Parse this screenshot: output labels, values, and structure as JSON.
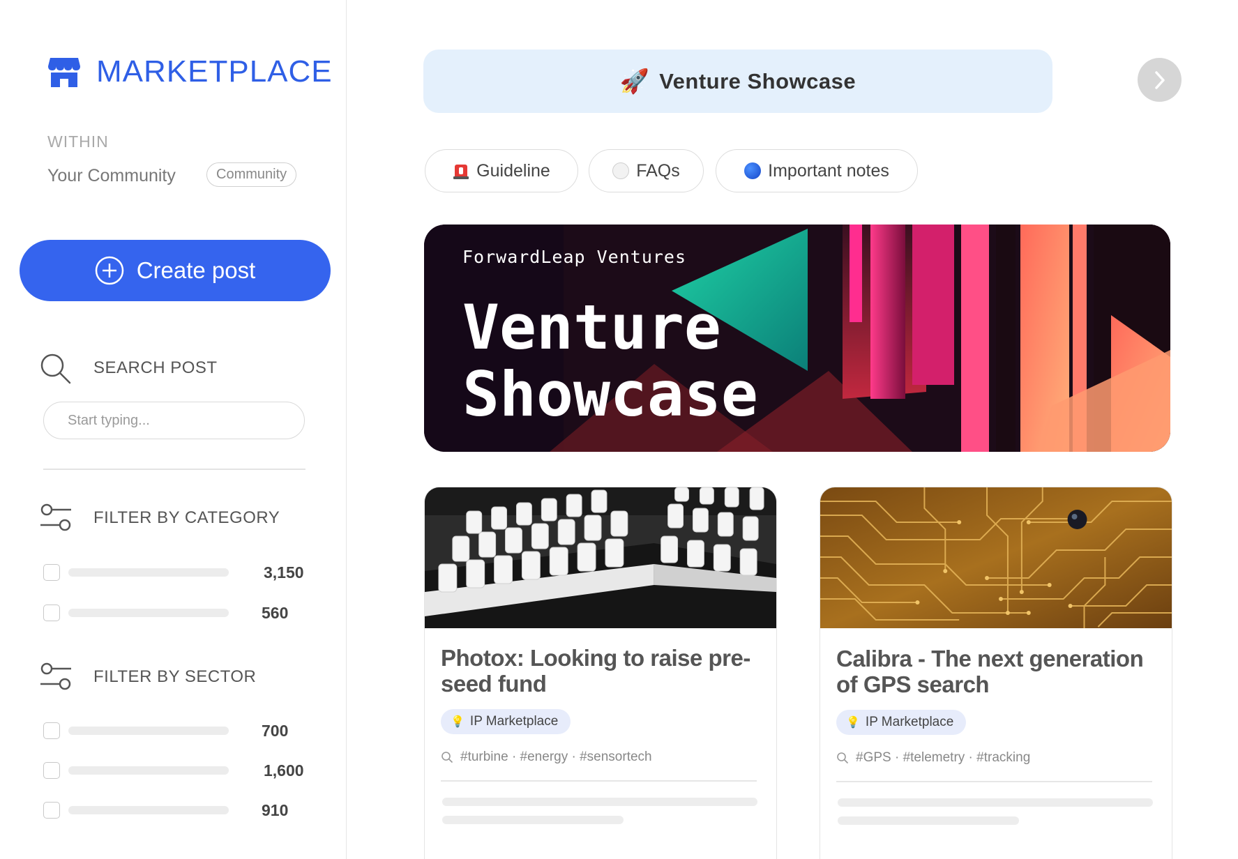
{
  "sidebar": {
    "brand": {
      "title": "MARKETPLACE",
      "icon": "storefront-icon"
    },
    "within_label": "WITHIN",
    "community_name": "Your Community",
    "community_badge": "Community",
    "create_post_label": "Create post",
    "search": {
      "heading": "SEARCH POST",
      "placeholder": "Start typing..."
    },
    "category_filter": {
      "heading": "FILTER BY CATEGORY",
      "counts": [
        "3,150",
        "560"
      ]
    },
    "sector_filter": {
      "heading": "FILTER BY SECTOR",
      "counts": [
        "700",
        "1,600",
        "910"
      ]
    }
  },
  "header": {
    "icon": "🚀",
    "title": "Venture Showcase"
  },
  "tabs": [
    {
      "label": "Guideline",
      "icon": "🚨"
    },
    {
      "label": "FAQs",
      "icon": "white-circle"
    },
    {
      "label": "Important notes",
      "icon": "blue-circle"
    }
  ],
  "banner": {
    "brand": "ForwardLeap Ventures",
    "title_line1": "Venture",
    "title_line2": "Showcase"
  },
  "cards": [
    {
      "title": "Photox: Looking to raise pre-seed fund",
      "tag": "IP Marketplace",
      "tag_icon": "💡",
      "hashtags": "#turbine · #energy · #sensortech",
      "image": "lab-vials-image"
    },
    {
      "title": "Calibra - The next generation of GPS search",
      "tag": "IP Marketplace",
      "tag_icon": "💡",
      "hashtags": "#GPS · #telemetry · #tracking",
      "image": "circuit-board-image"
    }
  ],
  "colors": {
    "accent": "#3564ee",
    "brand": "#2f5fe6",
    "header_bg": "#e4f0fc",
    "tag_bg": "#e7ecfb"
  }
}
